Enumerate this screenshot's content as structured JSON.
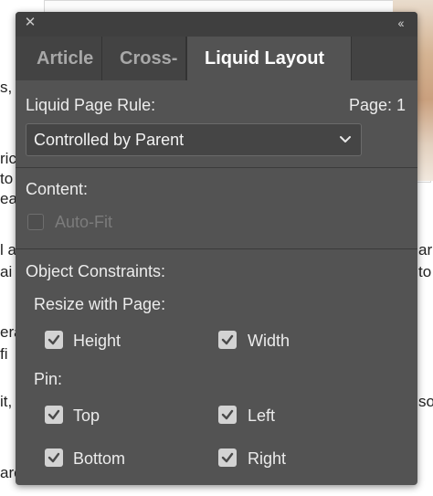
{
  "background": {
    "left_fragments": [
      "s,",
      "ric",
      "to",
      "ea",
      "l a",
      "ai",
      "era",
      "fi",
      "it,",
      "are"
    ],
    "right_fragments": [
      "ar",
      "to",
      "so"
    ]
  },
  "panel": {
    "close_glyph": "✕",
    "collapse_glyph": "‹‹",
    "tabs": [
      {
        "label": "Article"
      },
      {
        "label": "Cross-"
      },
      {
        "label": "Liquid Layout"
      }
    ],
    "rule_label": "Liquid Page Rule:",
    "page_label": "Page: 1",
    "rule_select_value": "Controlled by Parent",
    "content_label": "Content:",
    "autofit": {
      "label": "Auto-Fit",
      "checked": false,
      "enabled": false
    },
    "constraints_label": "Object Constraints:",
    "resize_label": "Resize with Page:",
    "resize": {
      "height": {
        "label": "Height",
        "checked": true
      },
      "width": {
        "label": "Width",
        "checked": true
      }
    },
    "pin_label": "Pin:",
    "pin": {
      "top": {
        "label": "Top",
        "checked": true
      },
      "left": {
        "label": "Left",
        "checked": true
      },
      "bottom": {
        "label": "Bottom",
        "checked": true
      },
      "right": {
        "label": "Right",
        "checked": true
      }
    }
  },
  "colors": {
    "panel_bg": "#535353",
    "titlebar_bg": "#3f3f3f",
    "active_tab_text": "#ffffff",
    "inactive_tab_text": "#a8a8a8",
    "checkbox_fill": "#d3d3d3",
    "check_mark": "#4a4a4a"
  }
}
